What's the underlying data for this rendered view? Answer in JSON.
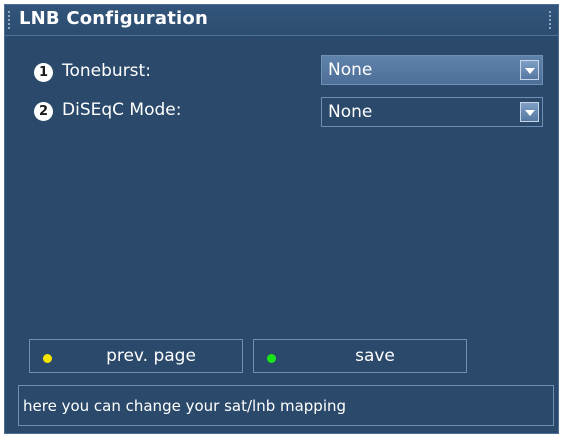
{
  "window": {
    "title": "LNB Configuration"
  },
  "settings": [
    {
      "number": "1",
      "label": "Toneburst:",
      "value": "None",
      "focused": true
    },
    {
      "number": "2",
      "label": "DiSEqC Mode:",
      "value": "None",
      "focused": false
    }
  ],
  "buttons": {
    "prev_page": {
      "label": "prev. page",
      "dot_color": "#f5e600"
    },
    "save": {
      "label": "save",
      "dot_color": "#19e619"
    }
  },
  "status": {
    "text": "here you can change your sat/lnb mapping"
  },
  "icons": {
    "dropdown": "chevron-down-icon",
    "yellow_key": "yellow-dot-icon",
    "green_key": "green-dot-icon"
  },
  "colors": {
    "background": "#2b4a6b",
    "border": "#6f90b4",
    "focus": "#5f82ab"
  }
}
